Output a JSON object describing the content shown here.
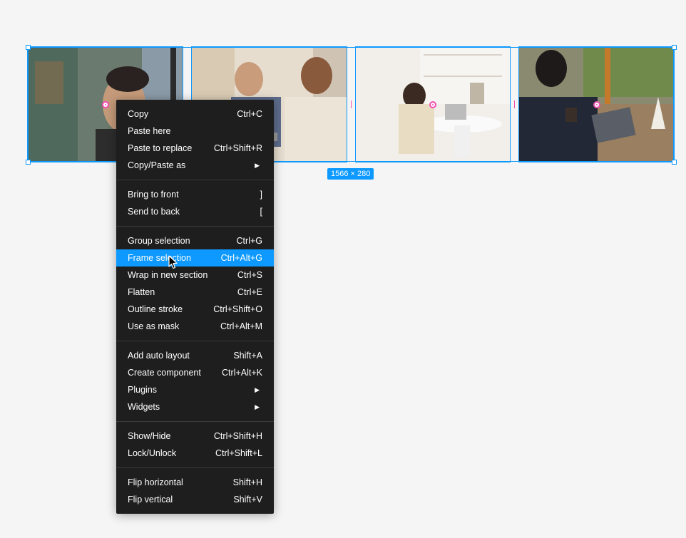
{
  "canvas": {
    "dimension_label": "1566 × 280"
  },
  "context_menu": {
    "groups": [
      [
        {
          "label": "Copy",
          "shortcut": "Ctrl+C"
        },
        {
          "label": "Paste here",
          "shortcut": ""
        },
        {
          "label": "Paste to replace",
          "shortcut": "Ctrl+Shift+R"
        },
        {
          "label": "Copy/Paste as",
          "shortcut": "",
          "submenu": true
        }
      ],
      [
        {
          "label": "Bring to front",
          "shortcut": "]"
        },
        {
          "label": "Send to back",
          "shortcut": "["
        }
      ],
      [
        {
          "label": "Group selection",
          "shortcut": "Ctrl+G"
        },
        {
          "label": "Frame selection",
          "shortcut": "Ctrl+Alt+G",
          "highlighted": true
        },
        {
          "label": "Wrap in new section",
          "shortcut": "Ctrl+S"
        },
        {
          "label": "Flatten",
          "shortcut": "Ctrl+E"
        },
        {
          "label": "Outline stroke",
          "shortcut": "Ctrl+Shift+O"
        },
        {
          "label": "Use as mask",
          "shortcut": "Ctrl+Alt+M"
        }
      ],
      [
        {
          "label": "Add auto layout",
          "shortcut": "Shift+A"
        },
        {
          "label": "Create component",
          "shortcut": "Ctrl+Alt+K"
        },
        {
          "label": "Plugins",
          "shortcut": "",
          "submenu": true
        },
        {
          "label": "Widgets",
          "shortcut": "",
          "submenu": true
        }
      ],
      [
        {
          "label": "Show/Hide",
          "shortcut": "Ctrl+Shift+H"
        },
        {
          "label": "Lock/Unlock",
          "shortcut": "Ctrl+Shift+L"
        }
      ],
      [
        {
          "label": "Flip horizontal",
          "shortcut": "Shift+H"
        },
        {
          "label": "Flip vertical",
          "shortcut": "Shift+V"
        }
      ]
    ]
  },
  "colors": {
    "selection": "#0d99ff",
    "spacing_marker": "#f24eb4",
    "menu_background": "#1e1e1e",
    "menu_highlight": "#0d99ff",
    "canvas_background": "#f5f5f5"
  },
  "icons": {
    "submenu": "chevron-right-icon",
    "cursor": "mouse-pointer-icon"
  }
}
